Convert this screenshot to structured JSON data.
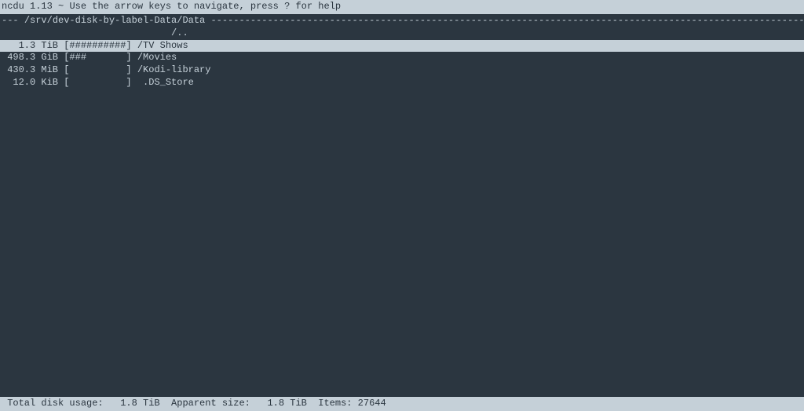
{
  "title": {
    "app": "ncdu",
    "version": "1.13",
    "separator": " ~ ",
    "hint": "Use the arrow keys to navigate, press ? for help"
  },
  "path": {
    "prefix": "--- ",
    "location": "/srv/dev-disk-by-label-Data/Data",
    "dashes": " ----------------------------------------------------------------------------------------------------------------------------------------------------------------------------------------"
  },
  "parent_row": "                              /..",
  "entries": [
    {
      "size": "   1.3 TiB",
      "bar": "[##########]",
      "name": "/TV Shows",
      "selected": true
    },
    {
      "size": " 498.3 GiB",
      "bar": "[###       ]",
      "name": "/Movies",
      "selected": false
    },
    {
      "size": " 430.3 MiB",
      "bar": "[          ]",
      "name": "/Kodi-library",
      "selected": false
    },
    {
      "size": "  12.0 KiB",
      "bar": "[          ]",
      "name": " .DS_Store",
      "selected": false
    }
  ],
  "status": {
    "total_label": " Total disk usage:",
    "total_value": "   1.8 TiB",
    "apparent_label": "  Apparent size:",
    "apparent_value": "   1.8 TiB",
    "items_label": "  Items:",
    "items_value": " 27644"
  }
}
